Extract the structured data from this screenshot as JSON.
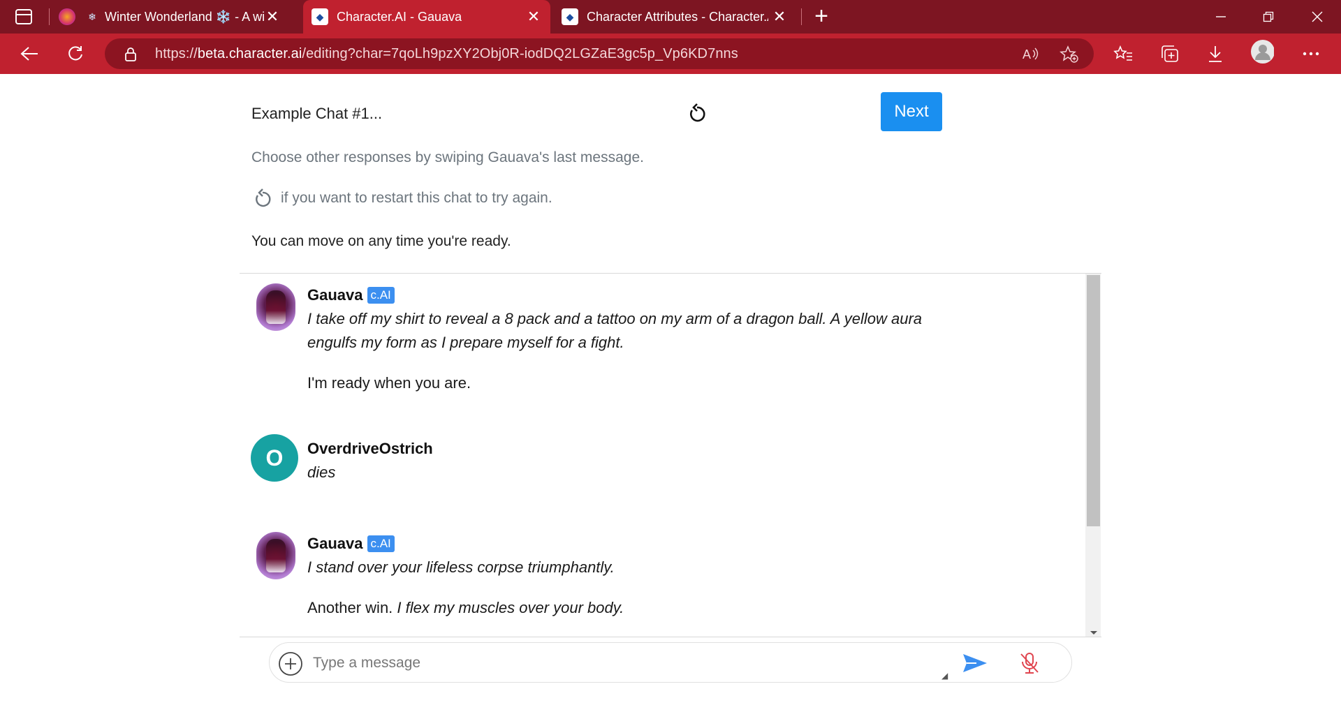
{
  "browser": {
    "tabs": [
      {
        "title": "Winter Wonderland ❄️ - A wi",
        "favicon": "snowflake-icon"
      },
      {
        "title": "Character.AI - Gauava",
        "favicon": "character-ai-icon",
        "active": true
      },
      {
        "title": "Character Attributes - Character.A",
        "favicon": "character-ai-icon"
      }
    ],
    "url_prefix": "https://",
    "url_host": "beta.character.ai",
    "url_path": "/editing?char=7qoLh9pzXY2Obj0R-iodDQ2LGZaE3gc5p_Vp6KD7nns",
    "accent_color": "#c0212f"
  },
  "header": {
    "title": "Example Chat #1...",
    "next_label": "Next"
  },
  "hints": {
    "swipe": "Choose other responses by swiping Gauava's last message.",
    "restart": "if you want to restart this chat to try again.",
    "move_on": "You can move on any time you're ready."
  },
  "messages": [
    {
      "sender": "Gauava",
      "badge": "c.AI",
      "lines": [
        "I take off my shirt to reveal a 8 pack and a tattoo on my arm of a dragon ball. A yellow aura",
        "engulfs my form as I prepare myself for a fight."
      ],
      "extra": "I'm ready when you are."
    },
    {
      "sender": "OverdriveOstrich",
      "avatar_letter": "O",
      "lines": [
        "dies"
      ]
    },
    {
      "sender": "Gauava",
      "badge": "c.AI",
      "lines": [
        "I stand over your lifeless corpse triumphantly."
      ],
      "extra_plain": "Another win.",
      "extra_italic": "I flex my muscles over your body."
    }
  ],
  "composer": {
    "placeholder": "Type a message"
  }
}
